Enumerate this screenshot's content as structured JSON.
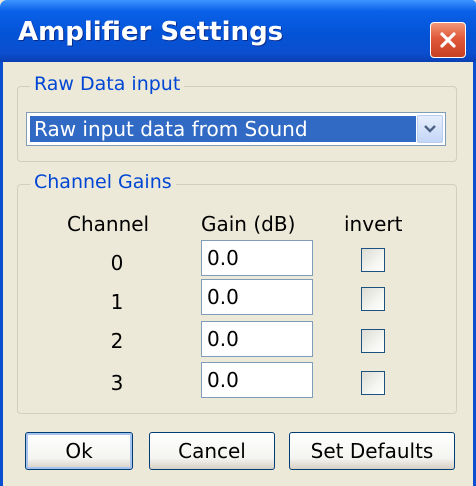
{
  "window": {
    "title": "Amplifier Settings",
    "close_icon": "close-icon"
  },
  "raw_input": {
    "legend": "Raw Data input",
    "selected": "Raw input data from Sound"
  },
  "gains": {
    "legend": "Channel Gains",
    "headers": {
      "channel": "Channel",
      "gain": "Gain (dB)",
      "invert": "invert"
    },
    "rows": [
      {
        "channel": "0",
        "gain": "0.0",
        "invert": false
      },
      {
        "channel": "1",
        "gain": "0.0",
        "invert": false
      },
      {
        "channel": "2",
        "gain": "0.0",
        "invert": false
      },
      {
        "channel": "3",
        "gain": "0.0",
        "invert": false
      }
    ]
  },
  "buttons": {
    "ok": "Ok",
    "cancel": "Cancel",
    "defaults": "Set Defaults"
  },
  "colors": {
    "titlebar": "#0453d6",
    "group_label": "#0046d5",
    "selection": "#316ac5",
    "close": "#e0593a"
  }
}
